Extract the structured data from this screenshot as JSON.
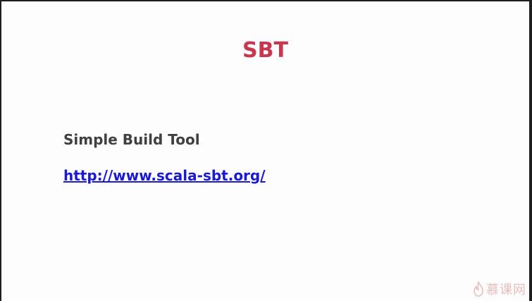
{
  "slide": {
    "title": "SBT",
    "subtitle": "Simple Build Tool",
    "link_text": "http://www.scala-sbt.org/"
  },
  "watermark": {
    "text": "慕课网",
    "icon": "flame-icon"
  },
  "colors": {
    "title": "#c7374f",
    "subtitle": "#404040",
    "link": "#1a1ad6",
    "background": "#fdfdfd",
    "watermark": "#d98a8a"
  }
}
